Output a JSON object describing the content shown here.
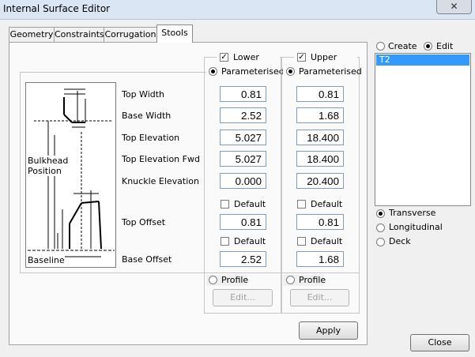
{
  "window": {
    "title": "Internal Surface Editor",
    "close_symbol": "✕"
  },
  "tabs": [
    {
      "label": "Geometry"
    },
    {
      "label": "Constraints"
    },
    {
      "label": "Corrugation"
    },
    {
      "label": "Stools"
    }
  ],
  "diagram": {
    "bulkhead_label": "Bulkhead Position",
    "baseline_label": "Baseline"
  },
  "rows": [
    {
      "label": "Top Width"
    },
    {
      "label": "Base Width"
    },
    {
      "label": "Top Elevation"
    },
    {
      "label": "Top Elevation Fwd"
    },
    {
      "label": "Knuckle Elevation"
    },
    {
      "label": "Top Offset"
    },
    {
      "label": "Base Offset"
    }
  ],
  "lower": {
    "label": "Lower",
    "checked": true,
    "parameterised_label": "Parameterised",
    "values": [
      "0.81",
      "2.52",
      "5.027",
      "5.027",
      "0.000"
    ],
    "top_offset_default": "Default",
    "top_offset": "0.81",
    "base_offset_default": "Default",
    "base_offset": "2.52",
    "profile_label": "Profile",
    "edit_label": "Edit..."
  },
  "upper": {
    "label": "Upper",
    "checked": true,
    "parameterised_label": "Parameterised",
    "values": [
      "0.81",
      "1.68",
      "18.400",
      "18.400",
      "20.400"
    ],
    "top_offset_default": "Default",
    "top_offset": "0.81",
    "base_offset_default": "Default",
    "base_offset": "1.68",
    "profile_label": "Profile",
    "edit_label": "Edit..."
  },
  "mode": {
    "create_label": "Create",
    "edit_label": "Edit",
    "selected": "Edit"
  },
  "list": {
    "items": [
      "T2"
    ],
    "selected": "T2"
  },
  "orientation": {
    "options": [
      "Transverse",
      "Longitudinal",
      "Deck"
    ],
    "selected": "Transverse"
  },
  "buttons": {
    "apply": "Apply",
    "close": "Close"
  },
  "checkmark": "✓"
}
